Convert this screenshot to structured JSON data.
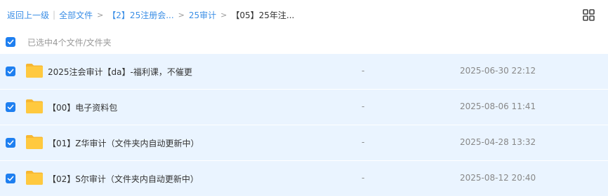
{
  "breadcrumb": {
    "back": "返回上一级",
    "all_files": "全部文件",
    "items": [
      "【2】25注册会...",
      "25审计",
      "【05】25年注..."
    ]
  },
  "icons": {
    "grid_toggle": "grid-view-icon",
    "folder": "folder-icon",
    "checkbox": "checkbox-checked-icon"
  },
  "colors": {
    "accent": "#1e7ff0",
    "link": "#3a8ee6",
    "row_selected_bg": "#eaf4ff",
    "folder": "#ffc63d"
  },
  "selection": {
    "label": "已选中4个文件/文件夹"
  },
  "files": [
    {
      "name": "2025注会审计【da】-福利课，不催更",
      "size": "-",
      "date": "2025-06-30 22:12",
      "selected": true
    },
    {
      "name": "【00】电子资料包",
      "size": "-",
      "date": "2025-08-06 11:41",
      "selected": true
    },
    {
      "name": "【01】Z华审计（文件夹内自动更新中）",
      "size": "-",
      "date": "2025-04-28 13:32",
      "selected": true
    },
    {
      "name": "【02】S尔审计（文件夹内自动更新中）",
      "size": "-",
      "date": "2025-08-12 20:40",
      "selected": true
    }
  ]
}
